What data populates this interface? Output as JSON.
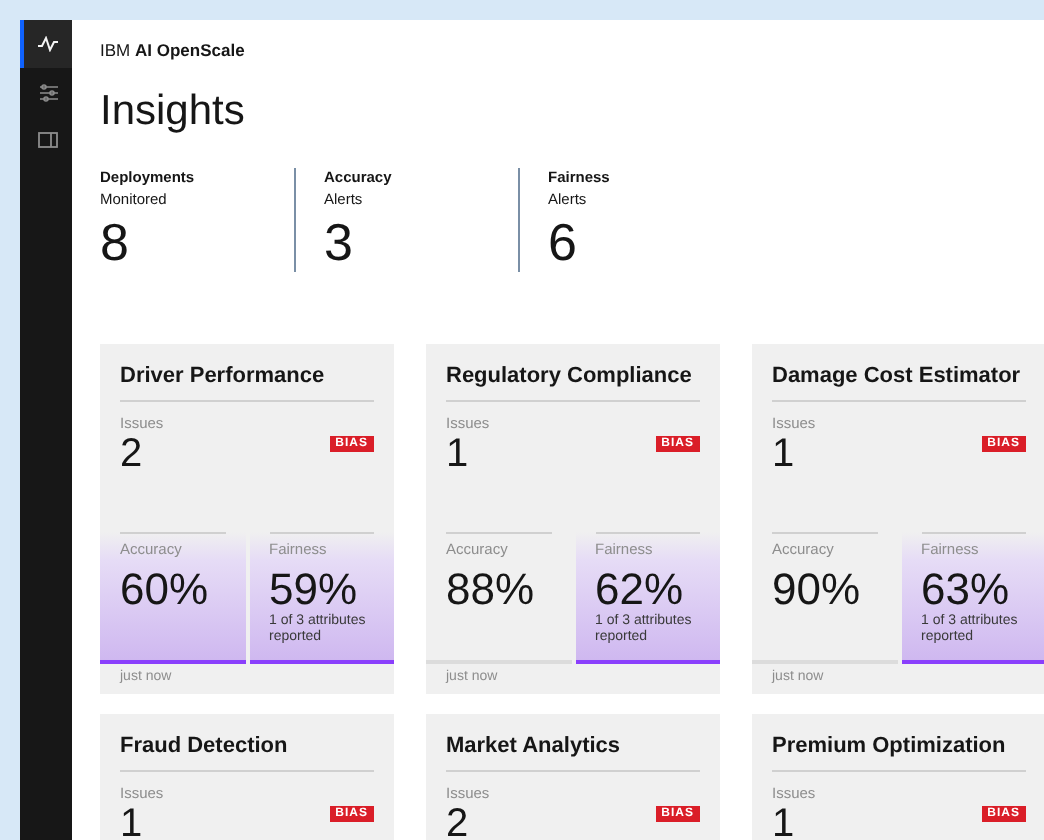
{
  "sidebar": {
    "items": [
      {
        "kind": "pulse",
        "selected": true
      },
      {
        "kind": "sliders",
        "selected": false
      },
      {
        "kind": "card",
        "selected": false
      }
    ]
  },
  "header": {
    "brand_prefix": "IBM",
    "brand_name": "AI OpenScale"
  },
  "title": "Insights",
  "summary": [
    {
      "label": "Deployments",
      "sublabel": "Monitored",
      "value": "8"
    },
    {
      "label": "Accuracy",
      "sublabel": "Alerts",
      "value": "3"
    },
    {
      "label": "Fairness",
      "sublabel": "Alerts",
      "value": "6"
    }
  ],
  "cards": [
    {
      "title": "Driver Performance",
      "issues_label": "Issues",
      "issues": "2",
      "tag": "BIAS",
      "metrics": [
        {
          "label": "Accuracy",
          "value": "60%",
          "alert": true
        },
        {
          "label": "Fairness",
          "value": "59%",
          "note": "1 of 3 attributes reported",
          "alert": true
        }
      ],
      "footer": "just now"
    },
    {
      "title": "Regulatory Compliance",
      "issues_label": "Issues",
      "issues": "1",
      "tag": "BIAS",
      "metrics": [
        {
          "label": "Accuracy",
          "value": "88%",
          "alert": false
        },
        {
          "label": "Fairness",
          "value": "62%",
          "note": "1 of 3 attributes reported",
          "alert": true
        }
      ],
      "footer": "just now"
    },
    {
      "title": "Damage Cost Estimator",
      "issues_label": "Issues",
      "issues": "1",
      "tag": "BIAS",
      "metrics": [
        {
          "label": "Accuracy",
          "value": "90%",
          "alert": false
        },
        {
          "label": "Fairness",
          "value": "63%",
          "note": "1 of 3 attributes reported",
          "alert": true
        }
      ],
      "footer": "just now"
    },
    {
      "title": "Fraud Detection",
      "issues_label": "Issues",
      "issues": "1",
      "tag": "BIAS"
    },
    {
      "title": "Market Analytics",
      "issues_label": "Issues",
      "issues": "2",
      "tag": "BIAS"
    },
    {
      "title": "Premium Optimization",
      "issues_label": "Issues",
      "issues": "1",
      "tag": "BIAS"
    }
  ]
}
